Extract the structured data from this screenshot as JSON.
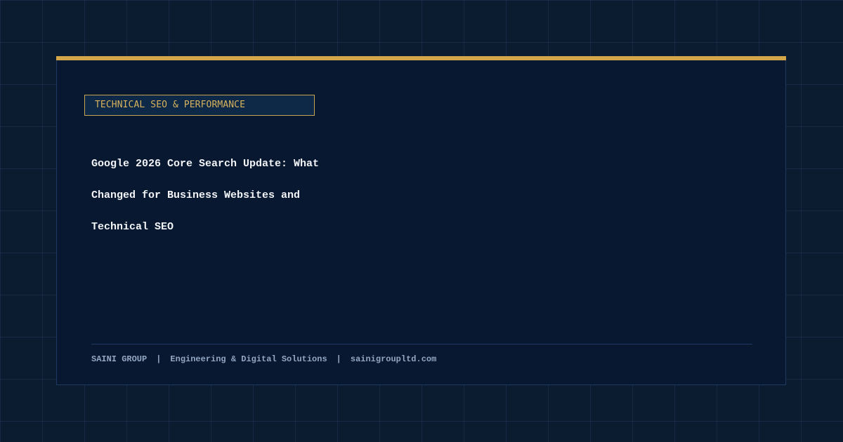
{
  "colors": {
    "background": "#0b1b30",
    "card_background": "#071830",
    "accent_gold": "#d4a64a",
    "card_border": "#1f3a62",
    "headline_text": "#f2f4f7",
    "footer_text": "#93a6c2"
  },
  "card": {
    "category": "TECHNICAL SEO & PERFORMANCE",
    "title_lines": [
      "Google 2026 Core Search Update: What",
      "Changed for Business Websites and",
      "Technical SEO"
    ]
  },
  "footer": {
    "brand": "SAINI GROUP",
    "separator": "|",
    "tagline": "Engineering & Digital Solutions",
    "website": "sainigroupltd.com"
  }
}
